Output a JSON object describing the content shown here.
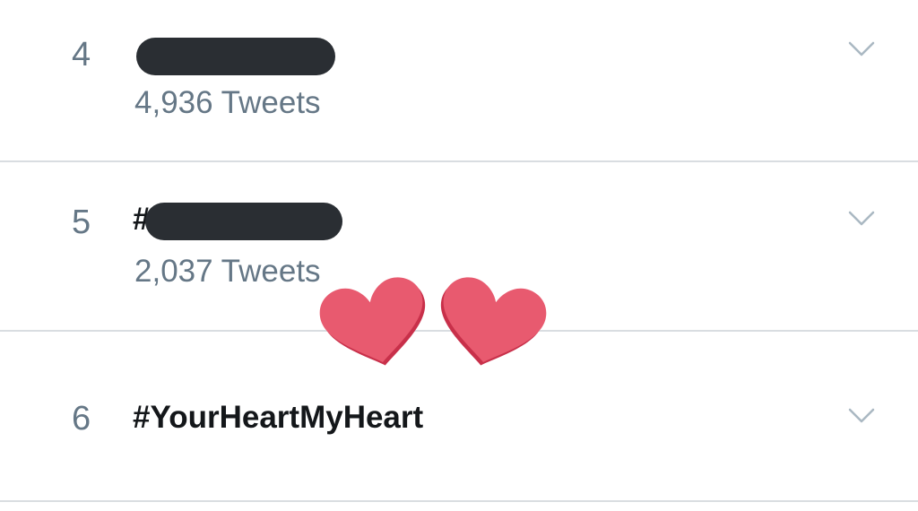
{
  "trends": [
    {
      "rank": "4",
      "name": "",
      "tweets": "4,936 Tweets"
    },
    {
      "rank": "5",
      "name": "#",
      "tweets": "2,037 Tweets"
    },
    {
      "rank": "6",
      "name": "#YourHeartMyHeart",
      "tweets": ""
    }
  ],
  "colors": {
    "text_primary": "#14171a",
    "text_secondary": "#657786",
    "divider": "#d9dde1",
    "chevron": "#aab8c2",
    "redaction": "#2a2e33",
    "heart": "#e85a6f",
    "heart_shadow": "#c8304a"
  },
  "icons": {
    "chevron": "chevron-down-icon",
    "sticker": "hearts-sticker"
  }
}
